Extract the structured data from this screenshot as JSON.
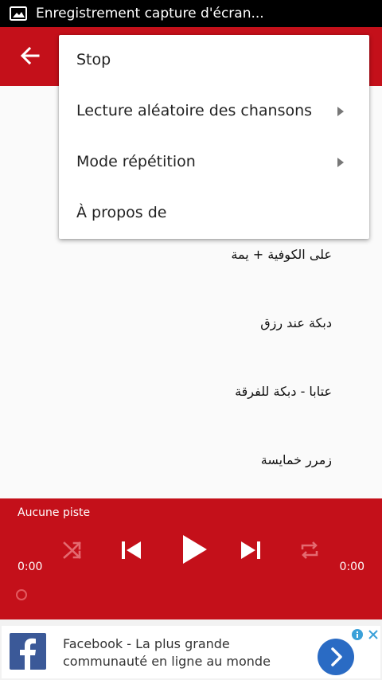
{
  "status_bar": {
    "title": "Enregistrement capture d'écran..."
  },
  "songs": [
    {
      "title": "على الكوفية + يمة"
    },
    {
      "title": "دبكة عند رزق"
    },
    {
      "title": "عتابا - دبكة للفرقة"
    },
    {
      "title": "زمرر خمايسة"
    }
  ],
  "menu": {
    "items": [
      {
        "label": "Stop"
      },
      {
        "label": "Lecture aléatoire des chansons"
      },
      {
        "label": "Mode répétition"
      },
      {
        "label": "À propos de"
      }
    ]
  },
  "player": {
    "track": "Aucune piste",
    "elapsed": "0:00",
    "duration": "0:00"
  },
  "ad": {
    "line1": "Facebook - La plus grande",
    "line2": "communauté en ligne au monde"
  },
  "colors": {
    "accent": "#c4101a",
    "ad_button": "#2a6bc4",
    "facebook": "#3b5998"
  }
}
